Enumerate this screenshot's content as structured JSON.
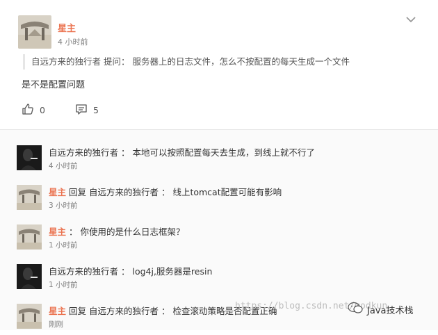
{
  "post": {
    "author": "星主",
    "time": "4 小时前",
    "quote": "自远方来的独行者 提问： 服务器上的日志文件，怎么不按配置的每天生成一个文件",
    "body": "是不是配置问题",
    "like_count": "0",
    "comment_count": "5"
  },
  "comments": [
    {
      "name": "自远方来的独行者",
      "sep": " ： ",
      "text": "本地可以按照配置每天去生成，到线上就不行了",
      "time": "4 小时前"
    },
    {
      "name": "星主",
      "reply_word": " 回复 ",
      "reply_to": "自远方来的独行者",
      "sep": " ： ",
      "text": "线上tomcat配置可能有影响",
      "time": "3 小时前"
    },
    {
      "name": "星主",
      "sep": " ： ",
      "text": "你使用的是什么日志框架？",
      "time": "1 小时前"
    },
    {
      "name": "自远方来的独行者",
      "sep": " ： ",
      "text": "log4j,服务器是resin",
      "time": "1 小时前"
    },
    {
      "name": "星主",
      "reply_word": " 回复 ",
      "reply_to": "自远方来的独行者",
      "sep": " ： ",
      "text": "检查滚动策略是否配置正确",
      "time": "刚刚"
    }
  ],
  "watermark": "https://blog.csdn.net/modkun",
  "brand": "Java技术栈"
}
